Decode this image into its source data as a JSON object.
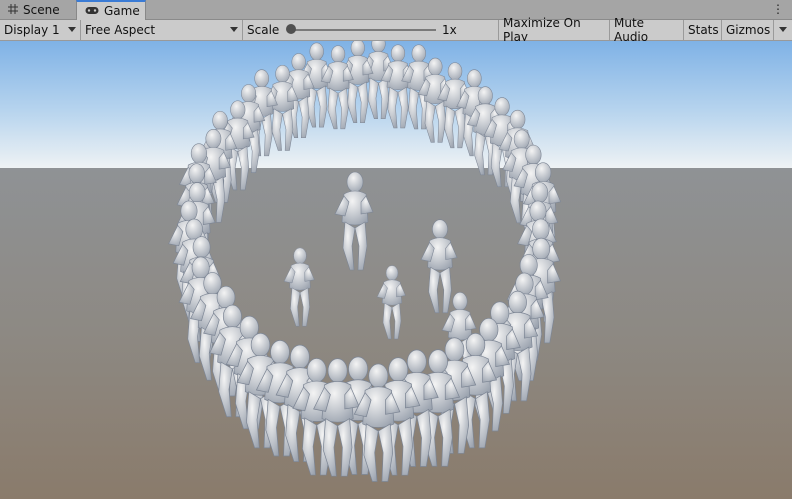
{
  "tabs": [
    {
      "label": "Scene",
      "icon": "grid-icon",
      "active": false
    },
    {
      "label": "Game",
      "icon": "gamepad-icon",
      "active": true
    }
  ],
  "toolbar": {
    "display": "Display 1",
    "aspect": "Free Aspect",
    "scale_label": "Scale",
    "scale_value": "1x",
    "maximize": "Maximize On Play",
    "mute": "Mute Audio",
    "stats": "Stats",
    "gizmos": "Gizmos"
  },
  "viewport": {
    "sky_top": "#7fb2e6",
    "horizon": "#e8eef2",
    "ground_top": "#8c8f92",
    "ground_bottom": "#8b7d6e",
    "figure_color": "#e6e6e6"
  }
}
